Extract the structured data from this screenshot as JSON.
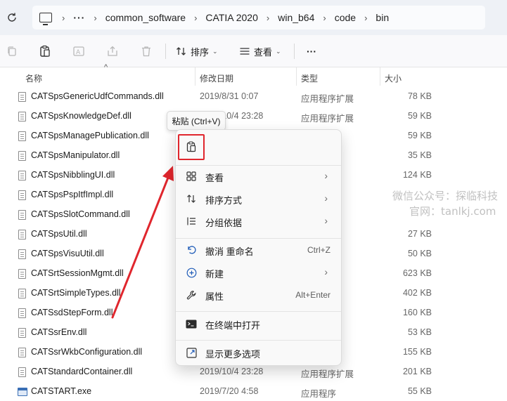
{
  "address_bar": {
    "breadcrumbs": [
      "common_software",
      "CATIA 2020",
      "win_b64",
      "code",
      "bin"
    ],
    "overflow": "···"
  },
  "toolbar": {
    "sort_label": "排序",
    "view_label": "查看",
    "more_label": "···"
  },
  "columns": {
    "name": "名称",
    "date": "修改日期",
    "type": "类型",
    "size": "大小"
  },
  "files": [
    {
      "name": "CATSpsGenericUdfCommands.dll",
      "date": "2019/8/31 0:07",
      "type": "应用程序扩展",
      "size": "78 KB",
      "icon": "dll-file-icon"
    },
    {
      "name": "CATSpsKnowledgeDef.dll",
      "date": "2019/10/4 23:28",
      "type": "应用程序扩展",
      "size": "59 KB",
      "icon": "dll-file-icon"
    },
    {
      "name": "CATSpsManagePublication.dll",
      "date": "",
      "type": "",
      "size": "59 KB",
      "icon": "dll-file-icon"
    },
    {
      "name": "CATSpsManipulator.dll",
      "date": "",
      "type": "",
      "size": "35 KB",
      "icon": "dll-file-icon"
    },
    {
      "name": "CATSpsNibblingUI.dll",
      "date": "",
      "type": "",
      "size": "124 KB",
      "icon": "dll-file-icon"
    },
    {
      "name": "CATSpsPspItfImpl.dll",
      "date": "",
      "type": "",
      "size": "",
      "icon": "dll-file-icon"
    },
    {
      "name": "CATSpsSlotCommand.dll",
      "date": "",
      "type": "",
      "size": "",
      "icon": "dll-file-icon"
    },
    {
      "name": "CATSpsUtil.dll",
      "date": "",
      "type": "",
      "size": "27 KB",
      "icon": "dll-file-icon"
    },
    {
      "name": "CATSpsVisuUtil.dll",
      "date": "",
      "type": "",
      "size": "50 KB",
      "icon": "dll-file-icon"
    },
    {
      "name": "CATSrtSessionMgmt.dll",
      "date": "",
      "type": "",
      "size": "623 KB",
      "icon": "dll-file-icon"
    },
    {
      "name": "CATSrtSimpleTypes.dll",
      "date": "",
      "type": "",
      "size": "402 KB",
      "icon": "dll-file-icon"
    },
    {
      "name": "CATSsdStepForm.dll",
      "date": "",
      "type": "",
      "size": "160 KB",
      "icon": "dll-file-icon"
    },
    {
      "name": "CATSsrEnv.dll",
      "date": "",
      "type": "",
      "size": "53 KB",
      "icon": "dll-file-icon"
    },
    {
      "name": "CATSsrWkbConfiguration.dll",
      "date": "",
      "type": "",
      "size": "155 KB",
      "icon": "dll-file-icon"
    },
    {
      "name": "CATStandardContainer.dll",
      "date": "2019/10/4 23:28",
      "type": "应用程序扩展",
      "size": "201 KB",
      "icon": "dll-file-icon"
    },
    {
      "name": "CATSTART.exe",
      "date": "2019/7/20 4:58",
      "type": "应用程序",
      "size": "55 KB",
      "icon": "exe-file-icon"
    }
  ],
  "tooltip": "粘贴 (Ctrl+V)",
  "context_menu": {
    "items": [
      {
        "label": "查看",
        "shortcut": "",
        "submenu": true,
        "icon": "grid-icon"
      },
      {
        "label": "排序方式",
        "shortcut": "",
        "submenu": true,
        "icon": "sort-icon"
      },
      {
        "label": "分组依据",
        "shortcut": "",
        "submenu": true,
        "icon": "group-list-icon"
      },
      {
        "label": "撤消 重命名",
        "shortcut": "Ctrl+Z",
        "submenu": false,
        "icon": "undo-icon"
      },
      {
        "label": "新建",
        "shortcut": "",
        "submenu": true,
        "icon": "new-plus-icon"
      },
      {
        "label": "属性",
        "shortcut": "Alt+Enter",
        "submenu": false,
        "icon": "wrench-icon"
      },
      {
        "label": "在终端中打开",
        "shortcut": "",
        "submenu": false,
        "icon": "terminal-icon"
      },
      {
        "label": "显示更多选项",
        "shortcut": "",
        "submenu": false,
        "icon": "more-options-icon"
      }
    ]
  },
  "watermark": {
    "line1": "微信公众号：探临科技",
    "line2": "官网：tanlkj.com"
  },
  "colors": {
    "highlight_box": "#e0262d",
    "arrow": "#e0262d",
    "topbar_bg": "#eef1f6"
  }
}
